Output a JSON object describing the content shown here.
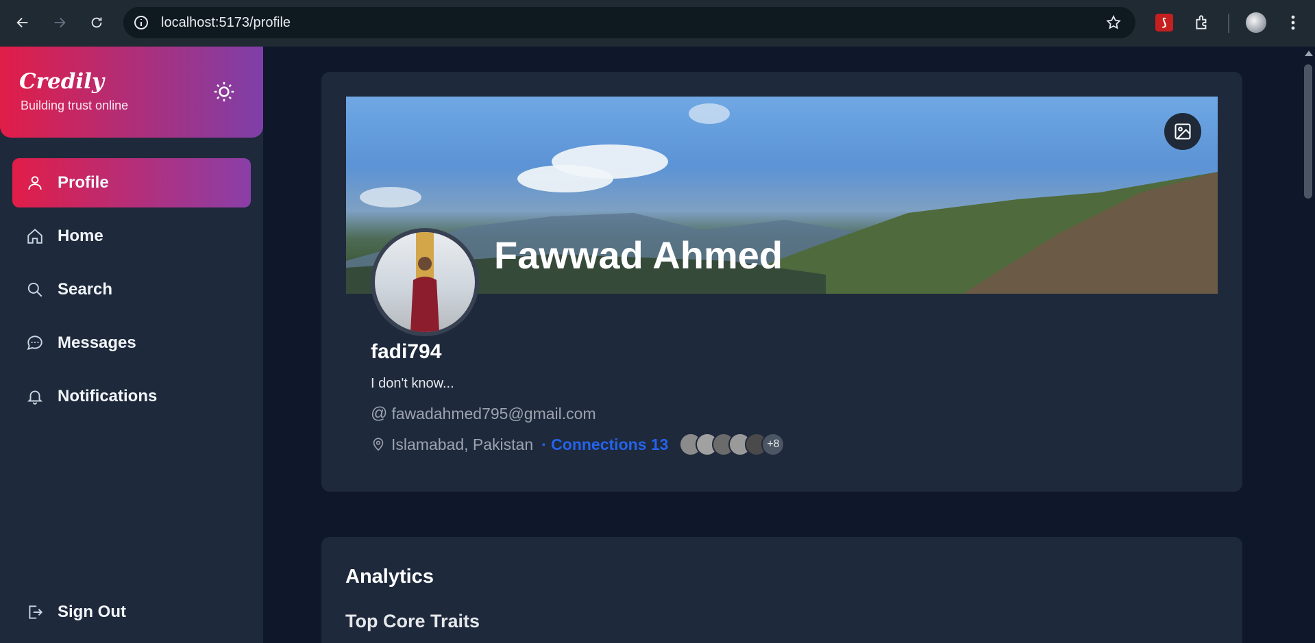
{
  "browser": {
    "url": "localhost:5173/profile"
  },
  "sidebar": {
    "brand": "Credily",
    "tagline": "Building trust online",
    "items": [
      {
        "label": "Profile",
        "icon": "user-icon",
        "active": true
      },
      {
        "label": "Home",
        "icon": "home-icon",
        "active": false
      },
      {
        "label": "Search",
        "icon": "search-icon",
        "active": false
      },
      {
        "label": "Messages",
        "icon": "message-icon",
        "active": false
      },
      {
        "label": "Notifications",
        "icon": "bell-icon",
        "active": false
      }
    ],
    "signout": "Sign Out"
  },
  "profile": {
    "full_name": "Fawwad Ahmed",
    "username": "fadi794",
    "bio": "I don't know...",
    "email": "fawadahmed795@gmail.com",
    "location": "Islamabad, Pakistan",
    "connections_label": "· Connections 13",
    "more_connections": "+8"
  },
  "analytics": {
    "title": "Analytics",
    "subtitle": "Top Core Traits"
  },
  "colors": {
    "accent_start": "#e11d48",
    "accent_end": "#8a3fa8",
    "link": "#2563eb",
    "page_bg": "#0f172a",
    "card_bg": "#1e293b"
  }
}
